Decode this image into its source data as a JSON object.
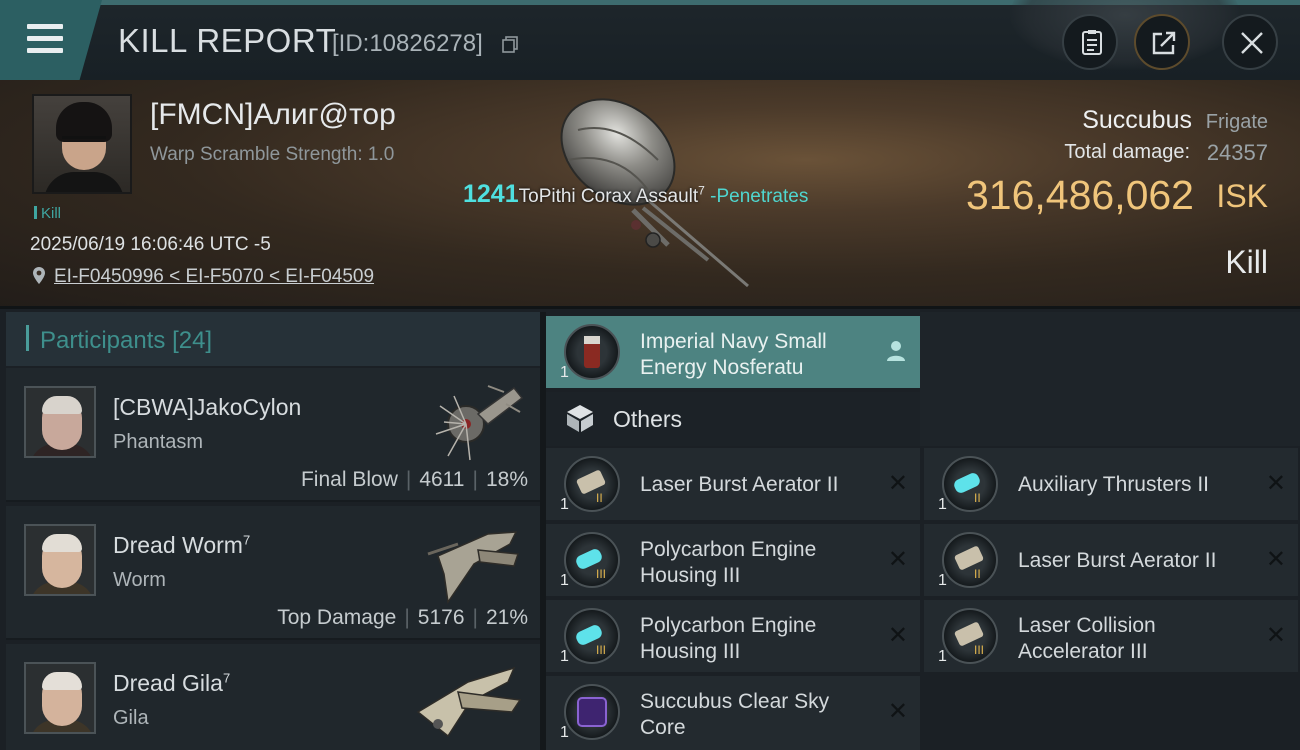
{
  "header": {
    "title": "KILL REPORT",
    "report_id": "[ID:10826278]"
  },
  "victim": {
    "name": "[FMCN]Алиг@тор",
    "warp_scramble": "Warp Scramble Strength: 1.0",
    "tag": "Kill",
    "datetime": "2025/06/19 16:06:46 UTC -5",
    "route": "EI-F0450996 < EI-F5070 < EI-F04509"
  },
  "hit": {
    "amount": "1241",
    "weapon": "ToPithi Corax Assault",
    "sup": "7",
    "effect": " -Penetrates"
  },
  "ship": {
    "name": "Succubus",
    "class": "Frigate",
    "total_damage_label": "Total damage:",
    "total_damage": "24357",
    "isk_value": "316,486,062",
    "isk_unit": "ISK",
    "result": "Kill"
  },
  "participants": {
    "label": "Participants",
    "count": "[24]",
    "rows": [
      {
        "name": "[CBWA]JakoCylon",
        "sup": "",
        "ship": "Phantasm",
        "role": "Final Blow",
        "damage": "4611",
        "percent": "18%"
      },
      {
        "name": "Dread Worm",
        "sup": "7",
        "ship": "Worm",
        "role": "Top Damage",
        "damage": "5176",
        "percent": "21%"
      },
      {
        "name": "Dread Gila",
        "sup": "7",
        "ship": "Gila",
        "role": "",
        "damage": "",
        "percent": ""
      }
    ]
  },
  "modules": {
    "highlight": {
      "name": "Imperial Navy Small Energy Nosferatu",
      "qty": "1"
    },
    "others_label": "Others",
    "left": [
      {
        "name": "Laser Burst Aerator II",
        "qty": "1"
      },
      {
        "name": "Polycarbon Engine Housing III",
        "qty": "1"
      },
      {
        "name": "Polycarbon Engine Housing III",
        "qty": "1"
      },
      {
        "name": "Succubus Clear Sky Core",
        "qty": "1"
      }
    ],
    "right": [
      {
        "name": "Auxiliary Thrusters II",
        "qty": "1"
      },
      {
        "name": "Laser Burst Aerator II",
        "qty": "1"
      },
      {
        "name": "Laser Collision Accelerator III",
        "qty": "1"
      }
    ]
  },
  "colors": {
    "accent_teal": "#2c5f62",
    "isk_gold": "#f0c57b",
    "damage_cyan": "#4fe0e0",
    "highlight_row": "#4d8381"
  },
  "icons": [
    "menu-icon",
    "copy-icon",
    "clipboard-icon",
    "share-icon",
    "close-icon",
    "location-pin-icon",
    "cube-icon",
    "person-icon",
    "remove-icon"
  ]
}
